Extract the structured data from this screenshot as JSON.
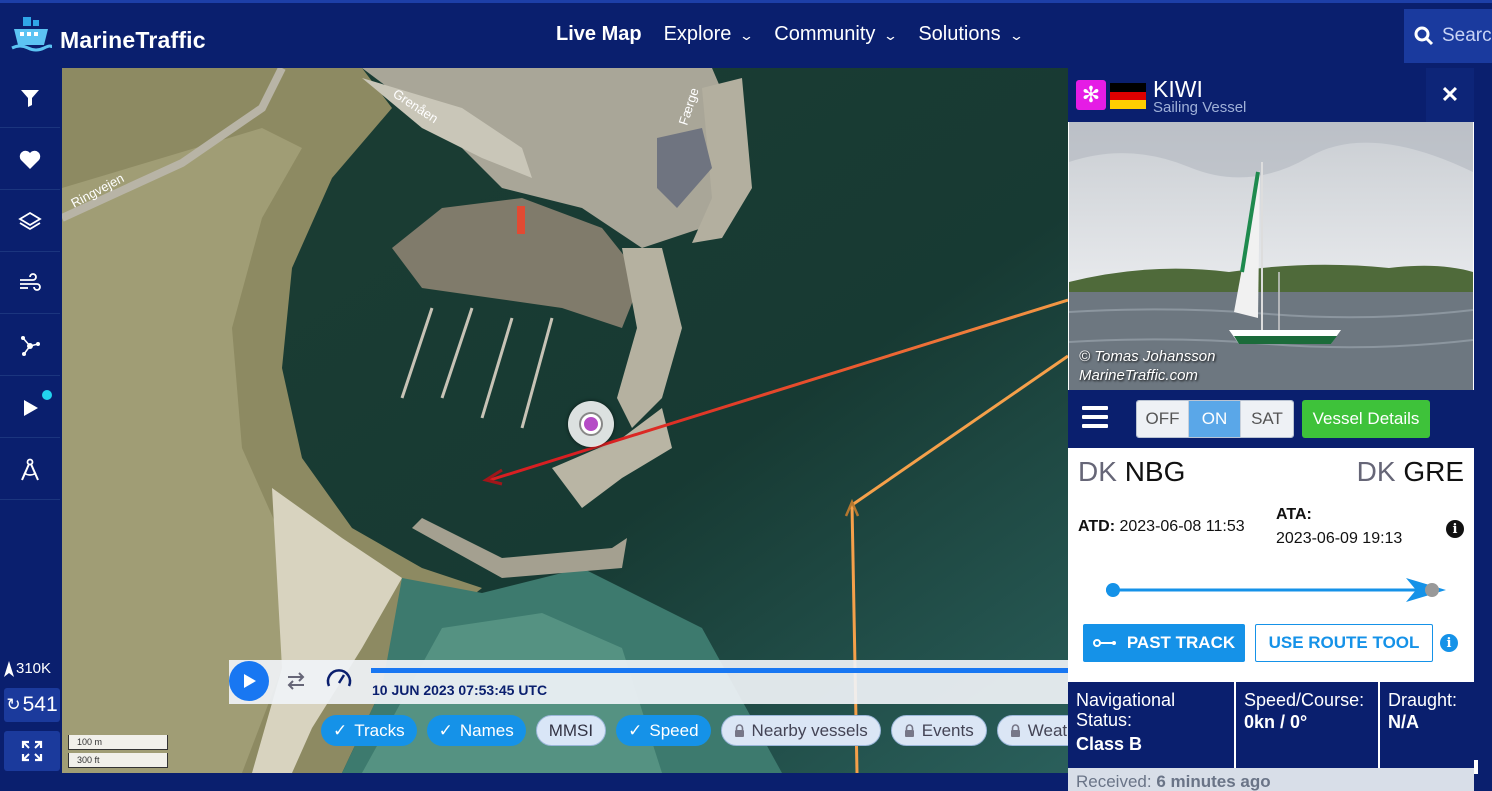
{
  "header": {
    "logo_text": "MarineTraffic",
    "nav": [
      {
        "label": "Live Map",
        "active": true,
        "dropdown": false
      },
      {
        "label": "Explore",
        "active": false,
        "dropdown": true
      },
      {
        "label": "Community",
        "active": false,
        "dropdown": true
      },
      {
        "label": "Solutions",
        "active": false,
        "dropdown": true
      }
    ],
    "search_placeholder": "Search"
  },
  "sidebar": {
    "items": [
      {
        "icon": "filter-icon"
      },
      {
        "icon": "heart-icon"
      },
      {
        "icon": "layers-icon"
      },
      {
        "icon": "wind-icon"
      },
      {
        "icon": "network-icon"
      },
      {
        "icon": "play-icon"
      },
      {
        "icon": "compass-icon"
      }
    ],
    "vessel_count": "310K",
    "refresh_count": "541"
  },
  "map": {
    "labels": {
      "road": "Ringvejen",
      "street1": "Grenåen",
      "street2": "Færge"
    },
    "scale_m": "100 m",
    "scale_ft": "300 ft"
  },
  "playback": {
    "timestamp": "10 JUN 2023 07:53:45 UTC"
  },
  "chips": [
    {
      "label": "Tracks",
      "state": "on"
    },
    {
      "label": "Names",
      "state": "on"
    },
    {
      "label": "MMSI",
      "state": "off"
    },
    {
      "label": "Speed",
      "state": "on"
    },
    {
      "label": "Nearby vessels",
      "state": "locked"
    },
    {
      "label": "Events",
      "state": "locked"
    },
    {
      "label": "Weather",
      "state": "locked"
    }
  ],
  "vessel": {
    "name": "KIWI",
    "type": "Sailing Vessel",
    "flag": "Germany",
    "photo_credit_1": "© Tomas Johansson",
    "photo_credit_2": "MarineTraffic.com",
    "map_toggle": [
      "OFF",
      "ON",
      "SAT"
    ],
    "map_toggle_selected": "ON",
    "details_label": "Vessel Details",
    "origin_cc": "DK",
    "origin_port": "NBG",
    "dest_cc": "DK",
    "dest_port": "GRE",
    "atd_label": "ATD:",
    "atd_value": "2023-06-08 11:53",
    "ata_label": "ATA:",
    "ata_value": "2023-06-09 19:13",
    "past_track_label": "PAST TRACK",
    "route_tool_label": "USE ROUTE TOOL",
    "nav_status_label": "Navigational Status:",
    "nav_status_value": "Class B",
    "speed_label": "Speed/Course:",
    "speed_value": "0kn / 0°",
    "draught_label": "Draught:",
    "draught_value": "N/A",
    "received_label": "Received:",
    "received_value": "6 minutes ago"
  },
  "colors": {
    "brand_navy": "#0a1f6e",
    "accent_blue": "#1592e8",
    "green": "#3ec23a",
    "track_red": "#e0312a",
    "track_orange": "#f5a04a"
  }
}
